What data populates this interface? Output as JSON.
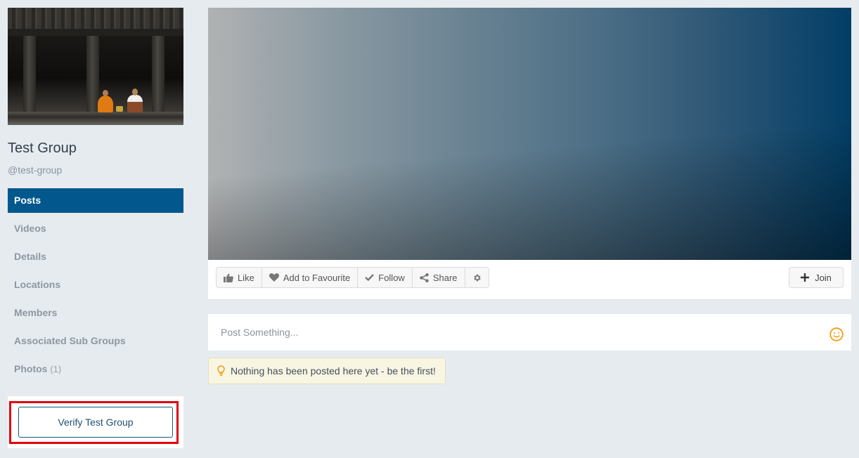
{
  "group": {
    "name": "Test Group",
    "handle": "@test-group",
    "cover_image": "monk-and-woman-in-temple-photo"
  },
  "sidebar": {
    "items": [
      {
        "label": "Posts",
        "active": true
      },
      {
        "label": "Videos",
        "active": false
      },
      {
        "label": "Details",
        "active": false
      },
      {
        "label": "Locations",
        "active": false
      },
      {
        "label": "Members",
        "active": false
      },
      {
        "label": "Associated Sub Groups",
        "active": false
      },
      {
        "label": "Photos",
        "count": "(1)",
        "active": false
      }
    ],
    "verify_button": "Verify Test Group"
  },
  "actions": {
    "like": {
      "label": "Like",
      "icon": "thumbs-up-icon"
    },
    "favourite": {
      "label": "Add to Favourite",
      "icon": "heart-icon"
    },
    "follow": {
      "label": "Follow",
      "icon": "check-icon"
    },
    "share": {
      "label": "Share",
      "icon": "share-icon"
    },
    "settings": {
      "icon": "gear-icon"
    },
    "join": {
      "label": "Join",
      "icon": "plus-icon"
    }
  },
  "composer": {
    "placeholder": "Post Something...",
    "value": "",
    "emoji_icon": "smiley-icon"
  },
  "notice": {
    "text": "Nothing has been posted here yet - be the first!",
    "icon": "lightbulb-icon"
  },
  "colors": {
    "accent": "#02588c",
    "background": "#e6ebef",
    "highlight_border": "#e3000f",
    "emoji": "#f39c12",
    "notice_bg": "#f8f5e3"
  }
}
